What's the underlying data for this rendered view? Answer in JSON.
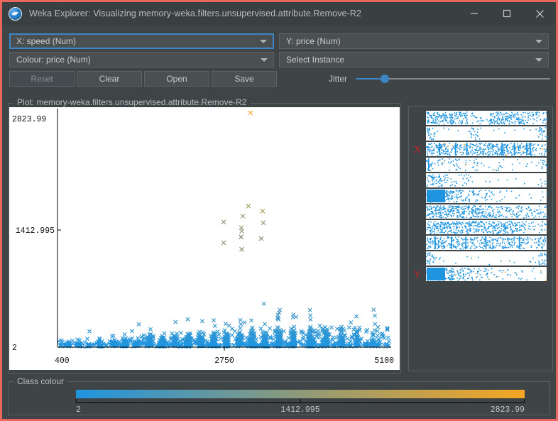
{
  "window": {
    "title": "Weka Explorer: Visualizing memory-weka.filters.unsupervised.attribute.Remove-R2",
    "icon": "weka-bird-icon",
    "minimize_label": "—",
    "maximize_label": "□",
    "close_label": "✕",
    "border_color": "#ec6660",
    "background": "#3f4447",
    "titlebar_background": "#3a3f42"
  },
  "controls": {
    "x_attribute": "X: speed (Num)",
    "y_attribute": "Y: price (Num)",
    "colour_attribute": "Colour: price (Num)",
    "instance_selector": "Select Instance",
    "buttons": [
      {
        "label": "Reset",
        "enabled": false
      },
      {
        "label": "Clear",
        "enabled": true
      },
      {
        "label": "Open",
        "enabled": true
      },
      {
        "label": "Save",
        "enabled": true
      }
    ],
    "jitter_label": "Jitter",
    "jitter_value_pct": 15,
    "accent_color": "#3d86c6"
  },
  "plot": {
    "title": "Plot: memory-weka.filters.unsupervised.attribute.Remove-R2",
    "background": "#ffffff",
    "marker": "x-cross"
  },
  "attribute_panel": {
    "x_marker": "X",
    "y_marker": "Y",
    "marker_color": "#cc2222",
    "row_count": 11,
    "x_row_index": 2,
    "y_row_index": 10
  },
  "class_colour": {
    "title": "Class colour",
    "min_label": "2",
    "mid_label": "1412.995",
    "max_label": "2823.99",
    "gradient_start": "#1f95e0",
    "gradient_mid": "#8f9a78",
    "gradient_end": "#f5a623"
  },
  "chart_data": {
    "type": "scatter",
    "title": "Plot: memory-weka.filters.unsupervised.attribute.Remove-R2",
    "xlabel": "speed",
    "ylabel": "price",
    "xlim": [
      400,
      5100
    ],
    "ylim": [
      2,
      2823.99
    ],
    "xticks": [
      "400",
      "2750",
      "5100"
    ],
    "xtick_values": [
      400,
      2750,
      5100
    ],
    "yticks": [
      "2823.99",
      "1412.995",
      "2"
    ],
    "ytick_values": [
      2823.99,
      1412.995,
      2
    ],
    "grid": false,
    "legend": "colour-gradient",
    "colour_attribute": "price",
    "colour_scale": {
      "min": 2,
      "mid": 1412.995,
      "max": 2823.99,
      "colors": [
        "#1f95e0",
        "#8f9a78",
        "#f5a623"
      ]
    },
    "note": "Dense low-price band near y=2 with vertical clusters at discrete speed values; sparse high-price outliers coloured olive/orange.",
    "cluster_x_values": [
      560,
      700,
      840,
      1000,
      1180,
      1350,
      1520,
      1700,
      1880,
      2060,
      2240,
      2420,
      2600,
      2780,
      2960,
      3140,
      3320,
      3520,
      3720,
      3960,
      4180,
      4400,
      4620,
      4850
    ],
    "cluster_weights": [
      8,
      10,
      14,
      18,
      26,
      34,
      30,
      46,
      52,
      40,
      64,
      58,
      72,
      80,
      66,
      90,
      78,
      96,
      70,
      84,
      62,
      44,
      30,
      18
    ],
    "outliers": [
      {
        "x": 3120,
        "y": 2824,
        "color": "#f5a623"
      },
      {
        "x": 3090,
        "y": 1700,
        "color": "#a39a55"
      },
      {
        "x": 3290,
        "y": 1640,
        "color": "#a39a55"
      },
      {
        "x": 3010,
        "y": 1580,
        "color": "#8f9a78"
      },
      {
        "x": 2740,
        "y": 1510,
        "color": "#8f9a78"
      },
      {
        "x": 3300,
        "y": 1500,
        "color": "#8f9a78"
      },
      {
        "x": 2990,
        "y": 1440,
        "color": "#8f9a78"
      },
      {
        "x": 2995,
        "y": 1400,
        "color": "#8f9a78"
      },
      {
        "x": 2985,
        "y": 1330,
        "color": "#7d8f6d"
      },
      {
        "x": 3270,
        "y": 1310,
        "color": "#7d8f6d"
      },
      {
        "x": 2740,
        "y": 1260,
        "color": "#7d8f6d"
      },
      {
        "x": 2995,
        "y": 1180,
        "color": "#7d8f6d"
      }
    ]
  }
}
